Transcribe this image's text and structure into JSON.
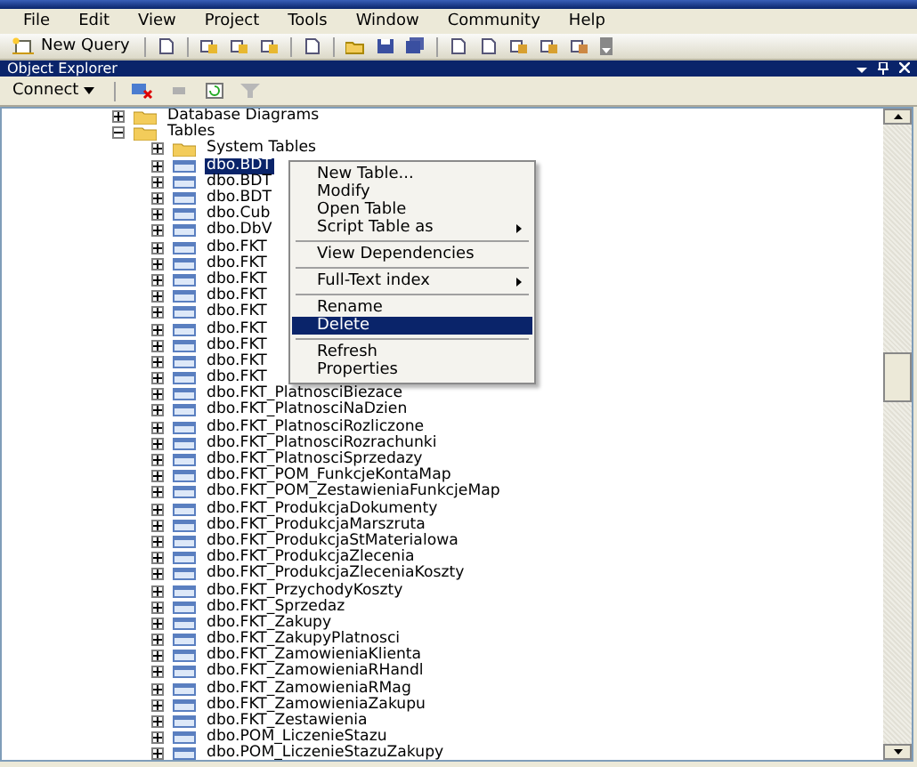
{
  "menu_bar": [
    "File",
    "Edit",
    "View",
    "Project",
    "Tools",
    "Window",
    "Community",
    "Help"
  ],
  "toolbar": {
    "new_query": "New Query"
  },
  "object_explorer": {
    "title": "Object Explorer",
    "connect": "Connect"
  },
  "tree": [
    {
      "label": "Database Diagrams",
      "kind": "folder",
      "expanded": false
    },
    {
      "label": "Tables",
      "kind": "folder",
      "expanded": true,
      "children": [
        {
          "label": "System Tables",
          "kind": "folder",
          "expanded": false,
          "selected": false
        },
        {
          "label": "dbo.BDT",
          "kind": "table",
          "expanded": false,
          "selected": true
        },
        {
          "label": "dbo.BDT",
          "kind": "table",
          "expanded": false,
          "selected": false
        },
        {
          "label": "dbo.BDT",
          "kind": "table",
          "expanded": false,
          "selected": false
        },
        {
          "label": "dbo.Cub",
          "kind": "table",
          "expanded": false,
          "selected": false
        },
        {
          "label": "dbo.DbV",
          "kind": "table",
          "expanded": false,
          "selected": false
        },
        {
          "label": "dbo.FKT",
          "kind": "table",
          "expanded": false,
          "selected": false
        },
        {
          "label": "dbo.FKT",
          "kind": "table",
          "expanded": false,
          "selected": false
        },
        {
          "label": "dbo.FKT",
          "kind": "table",
          "expanded": false,
          "selected": false
        },
        {
          "label": "dbo.FKT",
          "kind": "table",
          "expanded": false,
          "selected": false
        },
        {
          "label": "dbo.FKT",
          "kind": "table",
          "expanded": false,
          "selected": false
        },
        {
          "label": "dbo.FKT",
          "kind": "table",
          "expanded": false,
          "selected": false
        },
        {
          "label": "dbo.FKT",
          "kind": "table",
          "expanded": false,
          "selected": false
        },
        {
          "label": "dbo.FKT",
          "kind": "table",
          "expanded": false,
          "selected": false
        },
        {
          "label": "dbo.FKT",
          "kind": "table",
          "expanded": false,
          "selected": false
        },
        {
          "label": "dbo.FKT_PlatnosciBiezace",
          "kind": "table",
          "expanded": false,
          "selected": false
        },
        {
          "label": "dbo.FKT_PlatnosciNaDzien",
          "kind": "table",
          "expanded": false,
          "selected": false
        },
        {
          "label": "dbo.FKT_PlatnosciRozliczone",
          "kind": "table",
          "expanded": false,
          "selected": false
        },
        {
          "label": "dbo.FKT_PlatnosciRozrachunki",
          "kind": "table",
          "expanded": false,
          "selected": false
        },
        {
          "label": "dbo.FKT_PlatnosciSprzedazy",
          "kind": "table",
          "expanded": false,
          "selected": false
        },
        {
          "label": "dbo.FKT_POM_FunkcjeKontaMap",
          "kind": "table",
          "expanded": false,
          "selected": false
        },
        {
          "label": "dbo.FKT_POM_ZestawieniaFunkcjeMap",
          "kind": "table",
          "expanded": false,
          "selected": false
        },
        {
          "label": "dbo.FKT_ProdukcjaDokumenty",
          "kind": "table",
          "expanded": false,
          "selected": false
        },
        {
          "label": "dbo.FKT_ProdukcjaMarszruta",
          "kind": "table",
          "expanded": false,
          "selected": false
        },
        {
          "label": "dbo.FKT_ProdukcjaStMaterialowa",
          "kind": "table",
          "expanded": false,
          "selected": false
        },
        {
          "label": "dbo.FKT_ProdukcjaZlecenia",
          "kind": "table",
          "expanded": false,
          "selected": false
        },
        {
          "label": "dbo.FKT_ProdukcjaZleceniaKoszty",
          "kind": "table",
          "expanded": false,
          "selected": false
        },
        {
          "label": "dbo.FKT_PrzychodyKoszty",
          "kind": "table",
          "expanded": false,
          "selected": false
        },
        {
          "label": "dbo.FKT_Sprzedaz",
          "kind": "table",
          "expanded": false,
          "selected": false
        },
        {
          "label": "dbo.FKT_Zakupy",
          "kind": "table",
          "expanded": false,
          "selected": false
        },
        {
          "label": "dbo.FKT_ZakupyPlatnosci",
          "kind": "table",
          "expanded": false,
          "selected": false
        },
        {
          "label": "dbo.FKT_ZamowieniaKlienta",
          "kind": "table",
          "expanded": false,
          "selected": false
        },
        {
          "label": "dbo.FKT_ZamowieniaRHandl",
          "kind": "table",
          "expanded": false,
          "selected": false
        },
        {
          "label": "dbo.FKT_ZamowieniaRMag",
          "kind": "table",
          "expanded": false,
          "selected": false
        },
        {
          "label": "dbo.FKT_ZamowieniaZakupu",
          "kind": "table",
          "expanded": false,
          "selected": false
        },
        {
          "label": "dbo.FKT_Zestawienia",
          "kind": "table",
          "expanded": false,
          "selected": false
        },
        {
          "label": "dbo.POM_LiczenieStazu",
          "kind": "table",
          "expanded": false,
          "selected": false
        },
        {
          "label": "dbo.POM_LiczenieStazuZakupy",
          "kind": "table",
          "expanded": false,
          "selected": false
        }
      ]
    }
  ],
  "context_menu": [
    {
      "kind": "item",
      "label": "New Table...",
      "submenu": false,
      "selected": false
    },
    {
      "kind": "item",
      "label": "Modify",
      "submenu": false,
      "selected": false
    },
    {
      "kind": "item",
      "label": "Open Table",
      "submenu": false,
      "selected": false
    },
    {
      "kind": "item",
      "label": "Script Table as",
      "submenu": true,
      "selected": false
    },
    {
      "kind": "separator"
    },
    {
      "kind": "item",
      "label": "View Dependencies",
      "submenu": false,
      "selected": false
    },
    {
      "kind": "separator"
    },
    {
      "kind": "item",
      "label": "Full-Text index",
      "submenu": true,
      "selected": false
    },
    {
      "kind": "separator"
    },
    {
      "kind": "item",
      "label": "Rename",
      "submenu": false,
      "selected": false
    },
    {
      "kind": "item",
      "label": "Delete",
      "submenu": false,
      "selected": true
    },
    {
      "kind": "separator"
    },
    {
      "kind": "item",
      "label": "Refresh",
      "submenu": false,
      "selected": false
    },
    {
      "kind": "item",
      "label": "Properties",
      "submenu": false,
      "selected": false
    }
  ]
}
